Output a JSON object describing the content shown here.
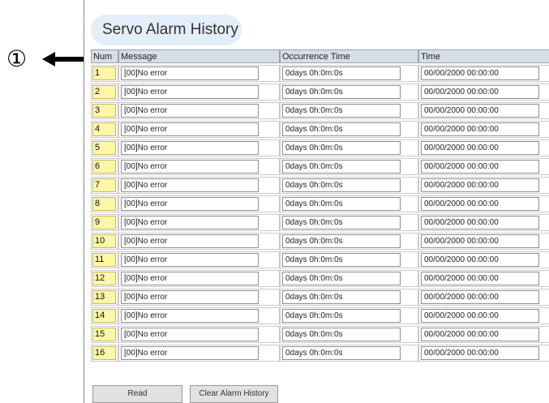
{
  "callout": {
    "symbol": "①"
  },
  "title": "Servo Alarm History",
  "columns": {
    "num": "Num",
    "message": "Message",
    "occurrence": "Occurrence Time",
    "time": "Time"
  },
  "rows": [
    {
      "num": "1",
      "message": "[00]No error",
      "occurrence": "0days 0h:0m:0s",
      "time": "00/00/2000 00:00:00"
    },
    {
      "num": "2",
      "message": "[00]No error",
      "occurrence": "0days 0h:0m:0s",
      "time": "00/00/2000 00:00:00"
    },
    {
      "num": "3",
      "message": "[00]No error",
      "occurrence": "0days 0h:0m:0s",
      "time": "00/00/2000 00:00:00"
    },
    {
      "num": "4",
      "message": "[00]No error",
      "occurrence": "0days 0h:0m:0s",
      "time": "00/00/2000 00:00:00"
    },
    {
      "num": "5",
      "message": "[00]No error",
      "occurrence": "0days 0h:0m:0s",
      "time": "00/00/2000 00:00:00"
    },
    {
      "num": "6",
      "message": "[00]No error",
      "occurrence": "0days 0h:0m:0s",
      "time": "00/00/2000 00:00:00"
    },
    {
      "num": "7",
      "message": "[00]No error",
      "occurrence": "0days 0h:0m:0s",
      "time": "00/00/2000 00:00:00"
    },
    {
      "num": "8",
      "message": "[00]No error",
      "occurrence": "0days 0h:0m:0s",
      "time": "00/00/2000 00:00:00"
    },
    {
      "num": "9",
      "message": "[00]No error",
      "occurrence": "0days 0h:0m:0s",
      "time": "00/00/2000 00:00:00"
    },
    {
      "num": "10",
      "message": "[00]No error",
      "occurrence": "0days 0h:0m:0s",
      "time": "00/00/2000 00:00:00"
    },
    {
      "num": "11",
      "message": "[00]No error",
      "occurrence": "0days 0h:0m:0s",
      "time": "00/00/2000 00:00:00"
    },
    {
      "num": "12",
      "message": "[00]No error",
      "occurrence": "0days 0h:0m:0s",
      "time": "00/00/2000 00:00:00"
    },
    {
      "num": "13",
      "message": "[00]No error",
      "occurrence": "0days 0h:0m:0s",
      "time": "00/00/2000 00:00:00"
    },
    {
      "num": "14",
      "message": "[00]No error",
      "occurrence": "0days 0h:0m:0s",
      "time": "00/00/2000 00:00:00"
    },
    {
      "num": "15",
      "message": "[00]No error",
      "occurrence": "0days 0h:0m:0s",
      "time": "00/00/2000 00:00:00"
    },
    {
      "num": "16",
      "message": "[00]No error",
      "occurrence": "0days 0h:0m:0s",
      "time": "00/00/2000 00:00:00"
    }
  ],
  "buttons": {
    "read": "Read",
    "clear": "Clear Alarm History"
  },
  "colors": {
    "title_bg": "#e2eef9",
    "header_bg": "#d6dee7",
    "num_bg": "#fff7a8"
  },
  "icons": {
    "arrow": "left-arrow-icon"
  }
}
